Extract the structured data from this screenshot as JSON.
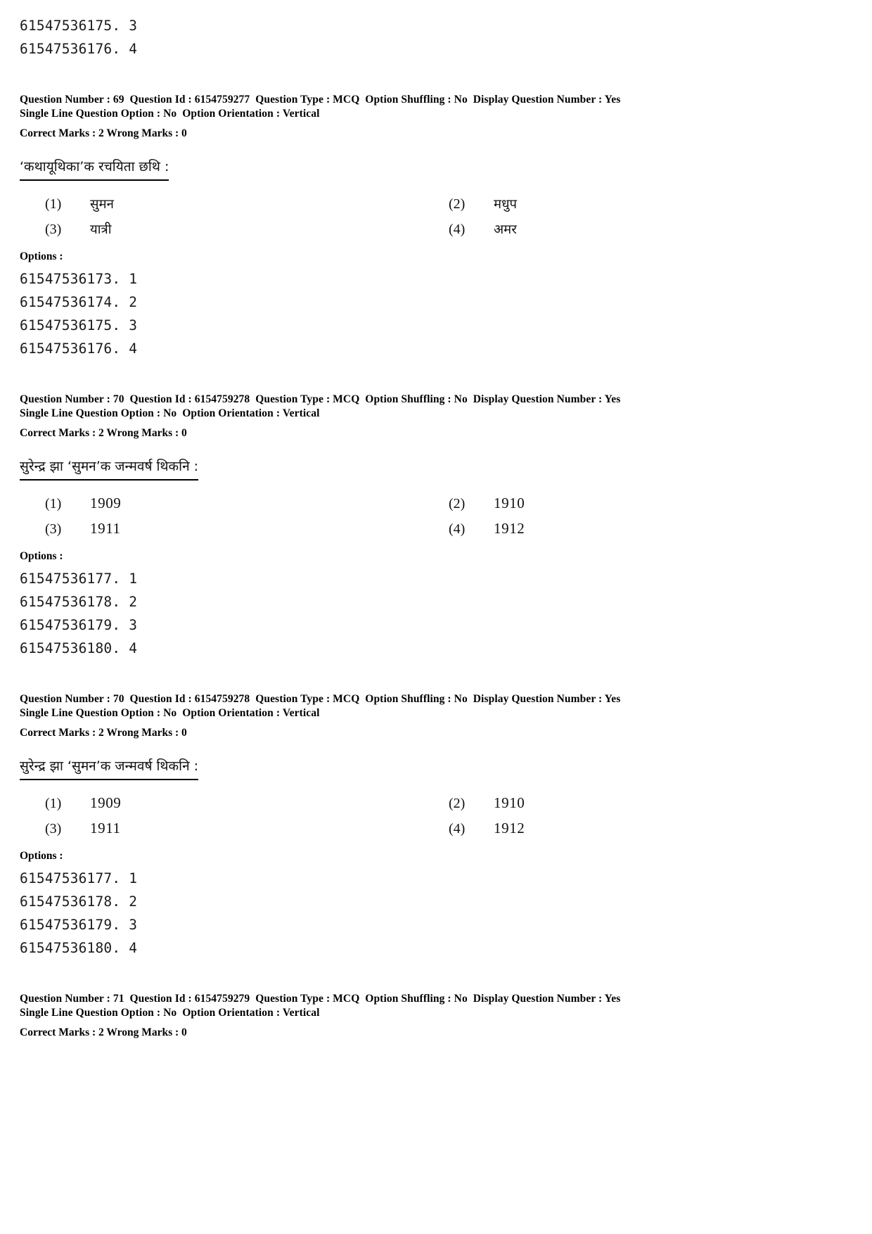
{
  "document": {
    "type": "exam-answer-key-page",
    "labels": {
      "options_heading": "Options :"
    }
  },
  "carryover_option_ids": [
    "61547536175. 3",
    "61547536176. 4"
  ],
  "questions": [
    {
      "meta_line1": "Question Number : 69  Question Id : 6154759277  Question Type : MCQ  Option Shuffling : No  Display Question Number : Yes",
      "meta_line2": "Single Line Question Option : No  Option Orientation : Vertical",
      "marks_line": "Correct Marks : 2  Wrong Marks : 0",
      "stem": "‘कथायूथिका’क रचयिता छथि :",
      "options_heading": "Options :",
      "choices": [
        {
          "num": "(1)",
          "text": "सुमन"
        },
        {
          "num": "(2)",
          "text": "मधुप"
        },
        {
          "num": "(3)",
          "text": "यात्री"
        },
        {
          "num": "(4)",
          "text": "अमर"
        }
      ],
      "option_ids": [
        "61547536173. 1",
        "61547536174. 2",
        "61547536175. 3",
        "61547536176. 4"
      ],
      "numeric_choices": false
    },
    {
      "meta_line1": "Question Number : 70  Question Id : 6154759278  Question Type : MCQ  Option Shuffling : No  Display Question Number : Yes",
      "meta_line2": "Single Line Question Option : No  Option Orientation : Vertical",
      "marks_line": "Correct Marks : 2  Wrong Marks : 0",
      "stem": "सुरेन्द्र झा ‘सुमन’क जन्मवर्ष थिकनि :",
      "options_heading": "Options :",
      "choices": [
        {
          "num": "(1)",
          "text": "1909"
        },
        {
          "num": "(2)",
          "text": "1910"
        },
        {
          "num": "(3)",
          "text": "1911"
        },
        {
          "num": "(4)",
          "text": "1912"
        }
      ],
      "option_ids": [
        "61547536177. 1",
        "61547536178. 2",
        "61547536179. 3",
        "61547536180. 4"
      ],
      "numeric_choices": true
    },
    {
      "meta_line1": "Question Number : 70  Question Id : 6154759278  Question Type : MCQ  Option Shuffling : No  Display Question Number : Yes",
      "meta_line2": "Single Line Question Option : No  Option Orientation : Vertical",
      "marks_line": "Correct Marks : 2  Wrong Marks : 0",
      "stem": "सुरेन्द्र झा ‘सुमन’क जन्मवर्ष थिकनि :",
      "options_heading": "Options :",
      "choices": [
        {
          "num": "(1)",
          "text": "1909"
        },
        {
          "num": "(2)",
          "text": "1910"
        },
        {
          "num": "(3)",
          "text": "1911"
        },
        {
          "num": "(4)",
          "text": "1912"
        }
      ],
      "option_ids": [
        "61547536177. 1",
        "61547536178. 2",
        "61547536179. 3",
        "61547536180. 4"
      ],
      "numeric_choices": true
    },
    {
      "meta_line1": "Question Number : 71  Question Id : 6154759279  Question Type : MCQ  Option Shuffling : No  Display Question Number : Yes",
      "meta_line2": "Single Line Question Option : No  Option Orientation : Vertical",
      "marks_line": "Correct Marks : 2  Wrong Marks : 0",
      "stem": "",
      "options_heading": "",
      "choices": [],
      "option_ids": [],
      "numeric_choices": false
    }
  ]
}
